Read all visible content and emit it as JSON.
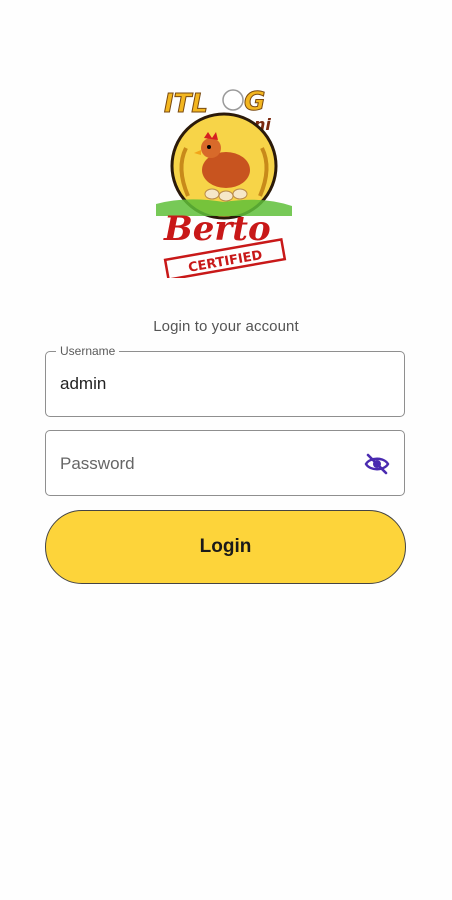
{
  "app": {
    "logo_text": {
      "line1": "ITLOG",
      "line2": "ni",
      "line3": "Berto",
      "stamp": "CERTIFIED"
    }
  },
  "login": {
    "subtitle": "Login to your account",
    "username": {
      "label": "Username",
      "value": "admin"
    },
    "password": {
      "placeholder": "Password",
      "visibility_icon": "eye-off-icon"
    },
    "button_label": "Login"
  },
  "colors": {
    "accent": "#fdd43a",
    "icon": "#4a2bb0"
  }
}
